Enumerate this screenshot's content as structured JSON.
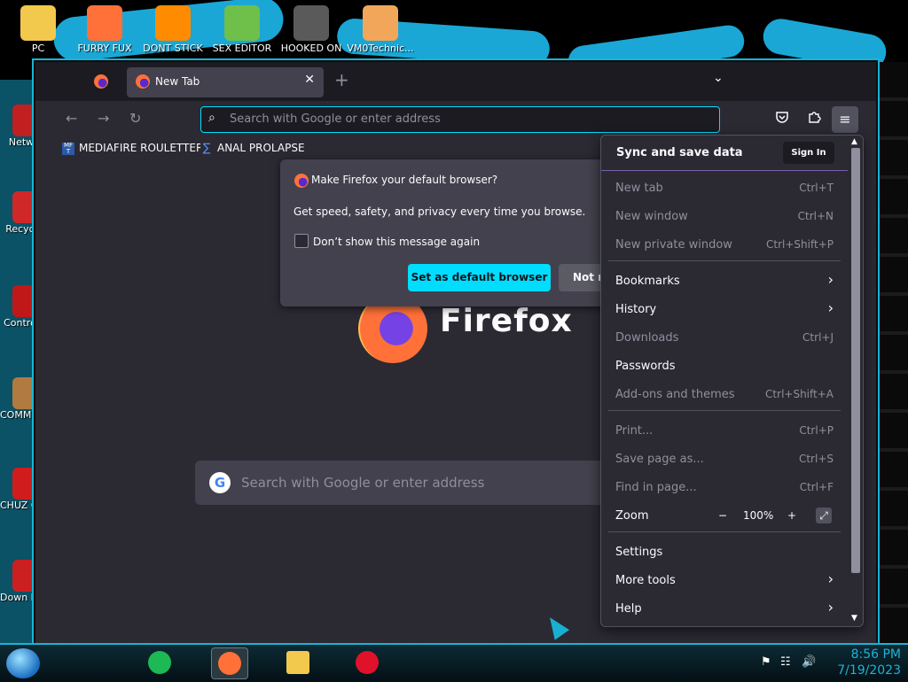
{
  "desktop": {
    "top_icons": [
      {
        "label": "PC",
        "color": "#f2c94c"
      },
      {
        "label": "FURRY FUX",
        "color": "#ff7139"
      },
      {
        "label": "DONT STICK",
        "color": "#ff8c00"
      },
      {
        "label": "SEX EDITOR",
        "color": "#6fbf4b"
      },
      {
        "label": "HOOKED ON",
        "color": "#5a5a5a"
      },
      {
        "label": "VM0Technic...",
        "color": "#f2a65a"
      }
    ],
    "side_icons": [
      {
        "label": "Netw",
        "color": "#c02020"
      },
      {
        "label": "Recycl",
        "color": "#d02828"
      },
      {
        "label": "Control",
        "color": "#c01818"
      },
      {
        "label": "COMMU HATE TH",
        "color": "#b07a40"
      },
      {
        "label": "CHUZ CUI",
        "color": "#d01c1c"
      },
      {
        "label": "Down Black",
        "color": "#cc2020"
      }
    ]
  },
  "browser": {
    "tab": {
      "title": "New Tab",
      "close": "✕"
    },
    "new_tab_glyph": "+",
    "tab_list_glyph": "⌄",
    "nav": {
      "back": "←",
      "forward": "→",
      "reload": "↻"
    },
    "urlbar": {
      "placeholder": "Search with Google or enter address",
      "icon": "search-icon"
    },
    "toolbar_icons": [
      "pocket-icon",
      "extensions-icon"
    ],
    "menu_glyph": "≡",
    "bookmarks": [
      {
        "label": "MEDIAFIRE ROULETTER",
        "icon": "MF T"
      },
      {
        "label": "ANAL PROLAPSE",
        "icon": "∑"
      }
    ],
    "newtab": {
      "wordmark": "Firefox",
      "search_placeholder": "Search with Google or enter address",
      "google_glyph": "G"
    }
  },
  "prompt": {
    "title": "Make Firefox your default browser?",
    "body": "Get speed, safety, and privacy every time you browse.",
    "checkbox_label": "Don’t show this message again",
    "primary": "Set as default browser",
    "secondary": "Not now"
  },
  "app_menu": {
    "header": "Sync and save data",
    "sign_in": "Sign In",
    "groups": [
      [
        {
          "label": "New tab",
          "shortcut": "Ctrl+T",
          "dim": true
        },
        {
          "label": "New window",
          "shortcut": "Ctrl+N",
          "dim": true
        },
        {
          "label": "New private window",
          "shortcut": "Ctrl+Shift+P",
          "dim": true
        }
      ],
      [
        {
          "label": "Bookmarks",
          "submenu": true
        },
        {
          "label": "History",
          "submenu": true
        },
        {
          "label": "Downloads",
          "shortcut": "Ctrl+J",
          "dim": true
        },
        {
          "label": "Passwords"
        },
        {
          "label": "Add-ons and themes",
          "shortcut": "Ctrl+Shift+A",
          "dim": true
        }
      ],
      [
        {
          "label": "Print...",
          "shortcut": "Ctrl+P",
          "dim": true
        },
        {
          "label": "Save page as...",
          "shortcut": "Ctrl+S",
          "dim": true
        },
        {
          "label": "Find in page...",
          "shortcut": "Ctrl+F",
          "dim": true
        },
        {
          "label": "Zoom",
          "zoom": true
        }
      ],
      [
        {
          "label": "Settings"
        },
        {
          "label": "More tools",
          "submenu": true
        },
        {
          "label": "Help",
          "submenu": true
        }
      ]
    ],
    "zoom": {
      "minus": "−",
      "value": "100%",
      "plus": "+",
      "fullscreen": "⤢"
    },
    "chevron": "›"
  },
  "taskbar": {
    "apps": [
      {
        "name": "spotify",
        "color": "#1db954"
      },
      {
        "name": "firefox",
        "color": "#ff7139",
        "active": true
      },
      {
        "name": "explorer",
        "color": "#f2c94c"
      },
      {
        "name": "opera",
        "color": "#e0112b"
      }
    ],
    "time": "8:56 PM",
    "date": "7/19/2023",
    "tray_icons": [
      "flag-icon",
      "network-icon",
      "volume-icon"
    ]
  },
  "colors": {
    "accent": "#00ddff",
    "wall_accent": "#1aa7d6"
  }
}
